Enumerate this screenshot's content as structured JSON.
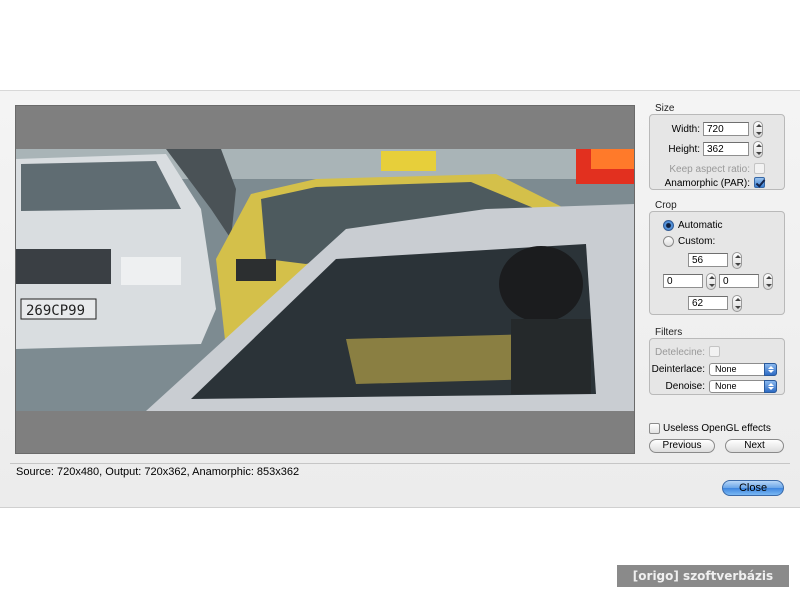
{
  "size": {
    "title": "Size",
    "width_label": "Width:",
    "width_value": "720",
    "height_label": "Height:",
    "height_value": "362",
    "keep_aspect_label": "Keep aspect ratio:",
    "keep_aspect_checked": false,
    "anamorphic_label": "Anamorphic (PAR):",
    "anamorphic_checked": true
  },
  "crop": {
    "title": "Crop",
    "automatic_label": "Automatic",
    "custom_label": "Custom:",
    "selected": "automatic",
    "top": "56",
    "left": "0",
    "right": "0",
    "bottom": "62"
  },
  "filters": {
    "title": "Filters",
    "detelecine_label": "Detelecine:",
    "deinterlace_label": "Deinterlace:",
    "deinterlace_value": "None",
    "denoise_label": "Denoise:",
    "denoise_value": "None"
  },
  "opengl_label": "Useless OpenGL effects",
  "buttons": {
    "previous": "Previous",
    "next": "Next",
    "close": "Close"
  },
  "status_text": "Source: 720x480, Output: 720x362, Anamorphic: 853x362",
  "watermark": "[origo] szoftverbázis",
  "colors": {
    "accent": "#3e86df",
    "taxi": "#d8c34a",
    "preview_bg": "#7f7f7f"
  }
}
